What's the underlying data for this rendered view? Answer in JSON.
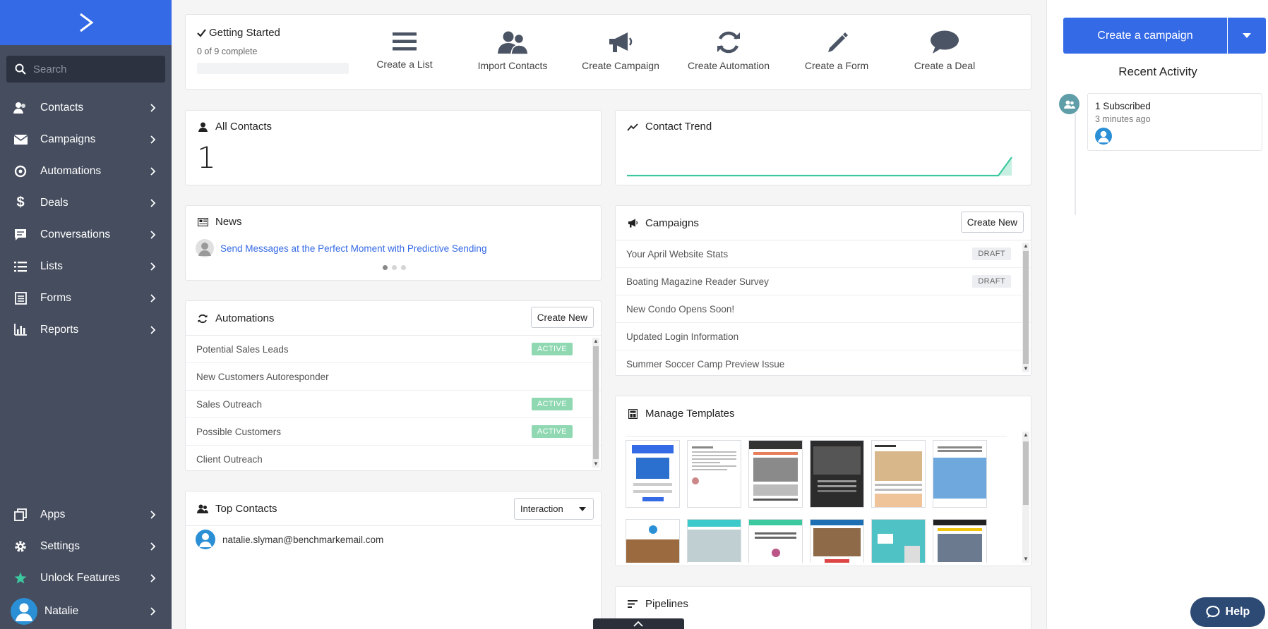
{
  "sidebar": {
    "search_placeholder": "Search",
    "items": [
      {
        "label": "Contacts",
        "icon": "contacts-icon"
      },
      {
        "label": "Campaigns",
        "icon": "envelope-icon"
      },
      {
        "label": "Automations",
        "icon": "automation-icon"
      },
      {
        "label": "Deals",
        "icon": "dollar-icon"
      },
      {
        "label": "Conversations",
        "icon": "chat-icon"
      },
      {
        "label": "Lists",
        "icon": "list-icon"
      },
      {
        "label": "Forms",
        "icon": "form-icon"
      },
      {
        "label": "Reports",
        "icon": "bar-chart-icon"
      }
    ],
    "bottom_items": [
      {
        "label": "Apps",
        "icon": "apps-icon"
      },
      {
        "label": "Settings",
        "icon": "gear-icon"
      },
      {
        "label": "Unlock Features",
        "icon": "star-icon"
      },
      {
        "label": "Natalie",
        "icon": "avatar-icon"
      }
    ]
  },
  "getting_started": {
    "title": "Getting Started",
    "progress_text": "0 of 9 complete",
    "progress_fraction": 0,
    "actions": [
      {
        "label": "Create a List"
      },
      {
        "label": "Import Contacts"
      },
      {
        "label": "Create Campaign"
      },
      {
        "label": "Create Automation"
      },
      {
        "label": "Create a Form"
      },
      {
        "label": "Create a Deal"
      }
    ]
  },
  "all_contacts": {
    "title": "All Contacts",
    "count": "1"
  },
  "contact_trend": {
    "title": "Contact Trend"
  },
  "news": {
    "title": "News",
    "headline": "Send Messages at the Perfect Moment with Predictive Sending"
  },
  "automations": {
    "title": "Automations",
    "create_label": "Create New",
    "rows": [
      {
        "name": "Potential Sales Leads",
        "status": "ACTIVE"
      },
      {
        "name": "New Customers Autoresponder",
        "status": ""
      },
      {
        "name": "Sales Outreach",
        "status": "ACTIVE"
      },
      {
        "name": "Possible Customers",
        "status": "ACTIVE"
      },
      {
        "name": "Client Outreach",
        "status": ""
      }
    ]
  },
  "campaigns": {
    "title": "Campaigns",
    "create_label": "Create New",
    "rows": [
      {
        "name": "Your April Website Stats",
        "status": "DRAFT"
      },
      {
        "name": "Boating Magazine Reader Survey",
        "status": "DRAFT"
      },
      {
        "name": "New Condo Opens Soon!",
        "status": ""
      },
      {
        "name": "Updated Login Information",
        "status": ""
      },
      {
        "name": "Summer Soccer Camp Preview Issue",
        "status": ""
      }
    ]
  },
  "templates": {
    "title": "Manage Templates"
  },
  "top_contacts": {
    "title": "Top Contacts",
    "sort_value": "Interaction",
    "contacts": [
      {
        "email": "natalie.slyman@benchmarkemail.com"
      }
    ]
  },
  "pipelines": {
    "title": "Pipelines"
  },
  "right": {
    "primary_button": "Create a campaign",
    "recent_activity_title": "Recent Activity",
    "activity": [
      {
        "text": "1 Subscribed",
        "time": "3 minutes ago"
      }
    ]
  },
  "help_label": "Help",
  "colors": {
    "brand": "#356ae6",
    "sidebar": "#454d5e",
    "active": "#8fd8b2",
    "trend": "#3cc9a0"
  }
}
